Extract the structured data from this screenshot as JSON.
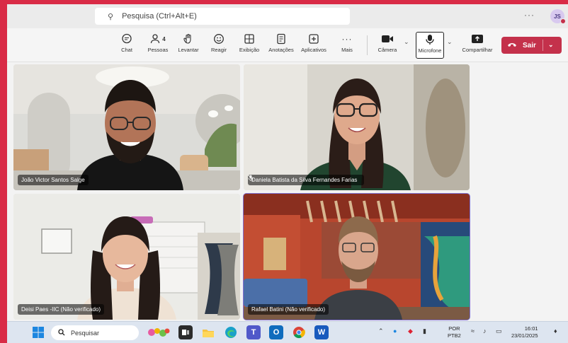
{
  "title_bar": {
    "search_placeholder": "Pesquisa (Ctrl+Alt+E)",
    "more": "···",
    "user_initials": "JS"
  },
  "toolbar": {
    "items": [
      {
        "label": "Chat",
        "icon": "chat-icon"
      },
      {
        "label": "Pessoas",
        "icon": "people-icon",
        "count": "4"
      },
      {
        "label": "Levantar",
        "icon": "raise-hand-icon"
      },
      {
        "label": "Reagir",
        "icon": "react-icon"
      },
      {
        "label": "Exibição",
        "icon": "view-icon"
      },
      {
        "label": "Anotações",
        "icon": "notes-icon"
      },
      {
        "label": "Aplicativos",
        "icon": "apps-icon"
      },
      {
        "label": "Mais",
        "icon": "more-icon"
      }
    ],
    "camera": "Câmera",
    "microphone": "Microfone",
    "share": "Compartilhar",
    "leave": "Sair"
  },
  "participants": [
    {
      "name": "João Victor Santos Salge",
      "muted": false,
      "speaking": false
    },
    {
      "name": "Daniela Batista da Silva Fernandes Farias",
      "muted": true,
      "speaking": false
    },
    {
      "name": "Deisi Paes -IIC (Não verificado)",
      "muted": false,
      "speaking": false
    },
    {
      "name": "Rafael Batini (Não verificado)",
      "muted": false,
      "speaking": true
    }
  ],
  "taskbar": {
    "search_placeholder": "Pesquisar",
    "language_line1": "POR",
    "language_line2": "PTB2",
    "time": "16:01",
    "date": "23/01/2025"
  },
  "colors": {
    "border": "#d92b46",
    "leave_button": "#c4314b",
    "active_speaker": "#7f6fd1"
  }
}
